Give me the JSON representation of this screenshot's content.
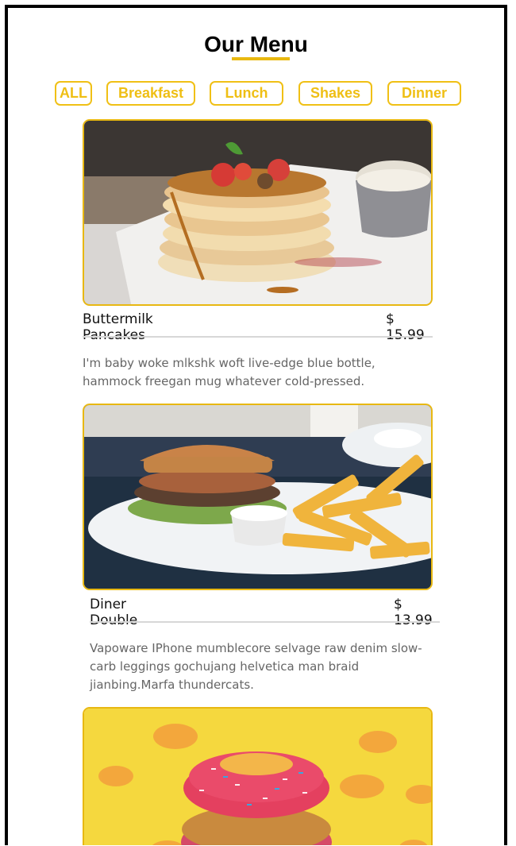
{
  "header": {
    "title": "Our Menu"
  },
  "filters": [
    "ALL",
    "Breakfast",
    "Lunch",
    "Shakes",
    "Dinner"
  ],
  "menu": [
    {
      "name": "Buttermilk Pancakes",
      "price": "$ 15.99",
      "description": "I'm baby woke mlkshk woft live-edge blue bottle, hammock freegan mug whatever cold-pressed.",
      "image": "pancakes-image"
    },
    {
      "name": "Diner Double",
      "price": "$ 13.99",
      "description": "Vapoware IPhone mumblecore selvage raw denim slow-carb leggings gochujang helvetica man braid jianbing.Marfa thundercats.",
      "image": "burger-fries-image"
    },
    {
      "name": "",
      "price": "",
      "description": "",
      "image": "donut-stack-image"
    }
  ],
  "colors": {
    "accent": "#efbf14",
    "text": "#111111",
    "muted": "#666666",
    "rule": "#d7d7d7"
  }
}
